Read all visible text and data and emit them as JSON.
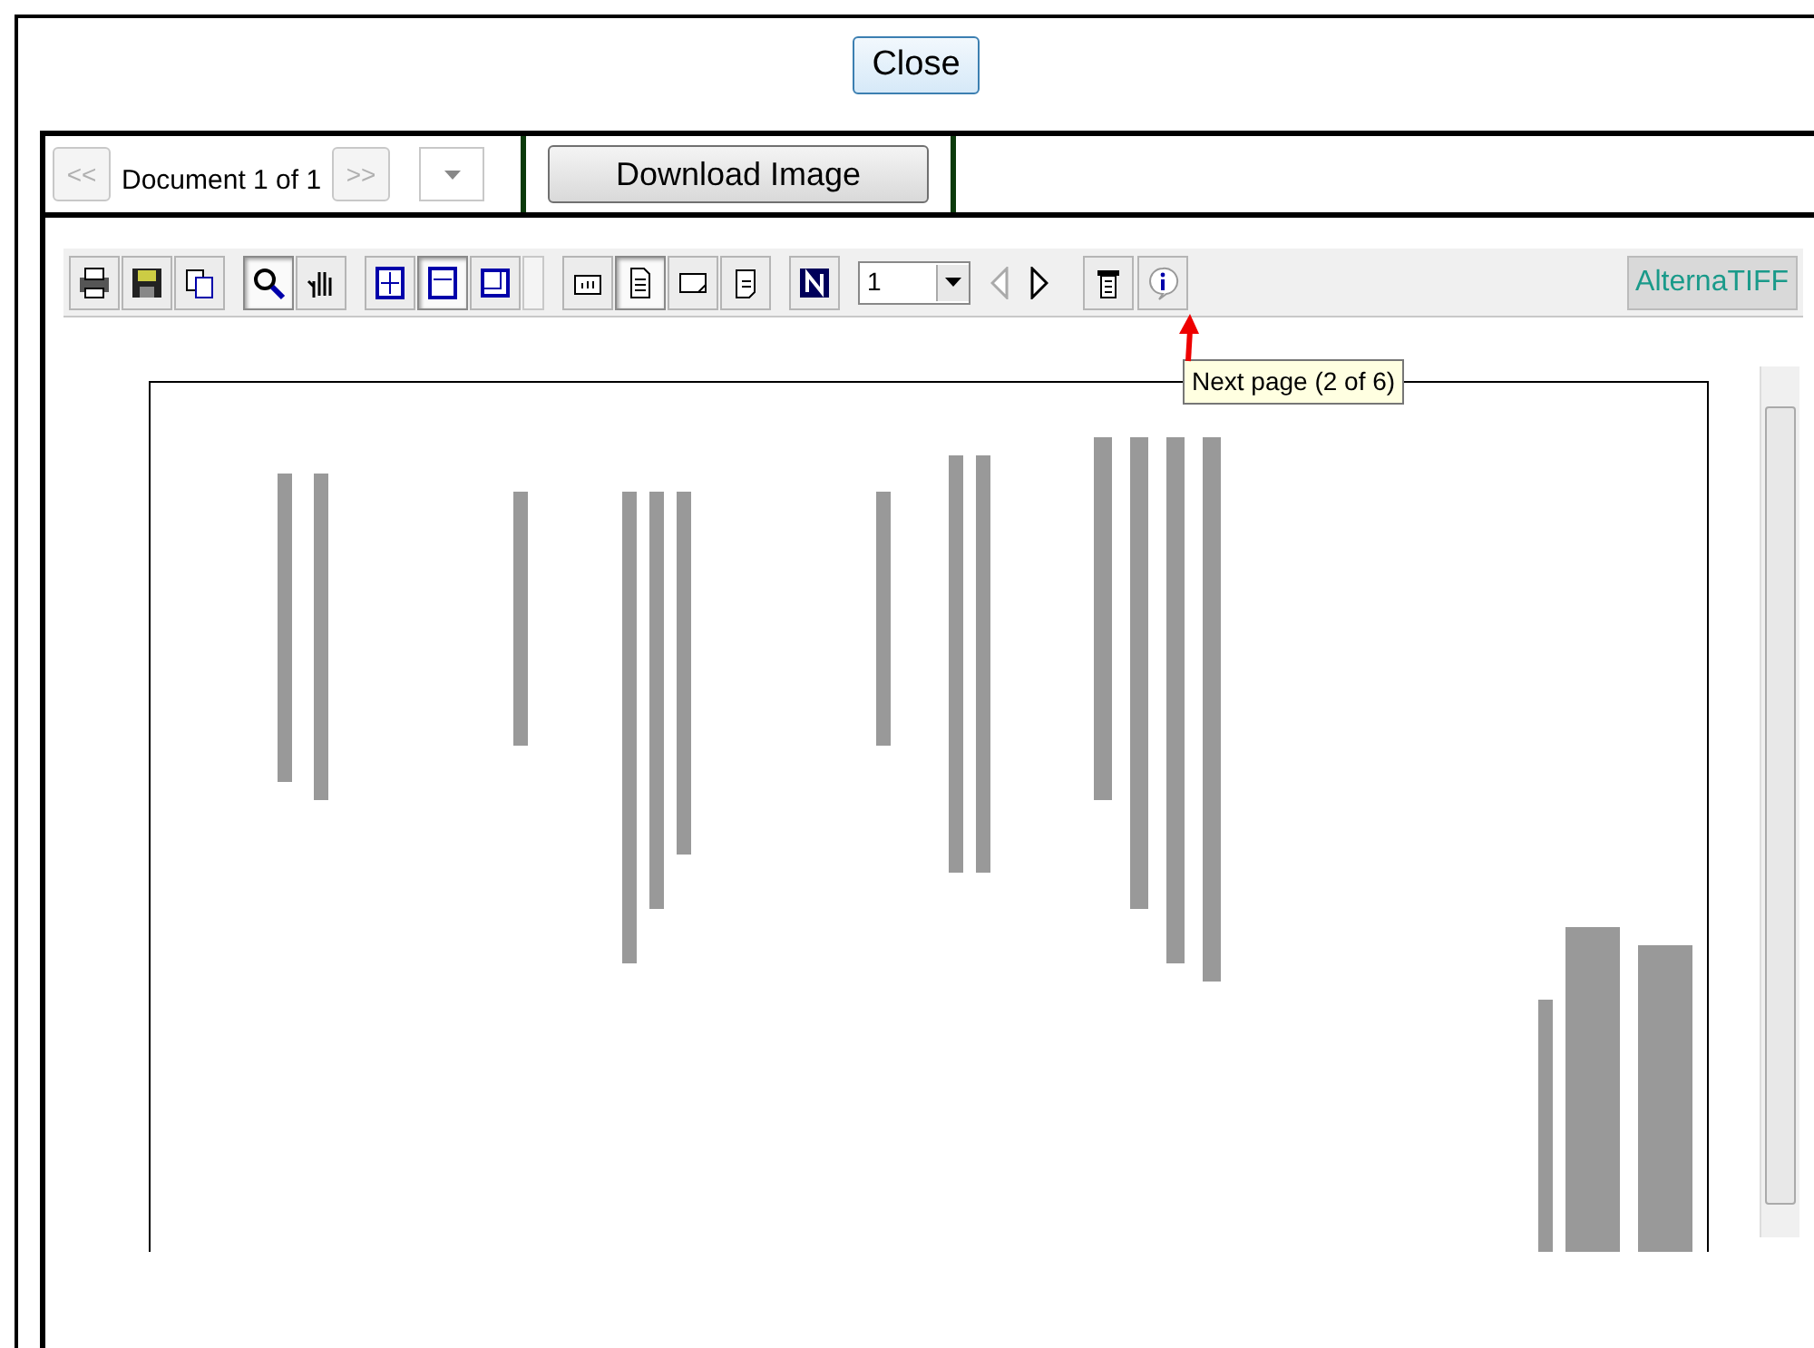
{
  "dialog": {
    "close_button": "Close"
  },
  "nav": {
    "prev": "<<",
    "prev_disabled": true,
    "label": "Document 1 of 1",
    "next": ">>",
    "next_disabled": true,
    "download": "Download Image"
  },
  "toolbar": {
    "groups": [
      [
        {
          "selected": false
        },
        {
          "selected": false
        },
        {
          "selected": false
        }
      ],
      [
        {
          "selected": true
        },
        {
          "selected": false
        }
      ],
      [
        {
          "selected": false
        },
        {
          "selected": true
        },
        {
          "selected": false
        }
      ],
      [
        {
          "selected": false
        },
        {
          "selected": true
        },
        {
          "selected": false
        },
        {
          "selected": false
        }
      ],
      [
        {
          "selected": false
        }
      ]
    ],
    "page_select": "1",
    "prev_page_disabled": true,
    "next_page_disabled": false,
    "brand": "AlternaTIFF"
  },
  "tooltip": "Next page (2 of 6)"
}
